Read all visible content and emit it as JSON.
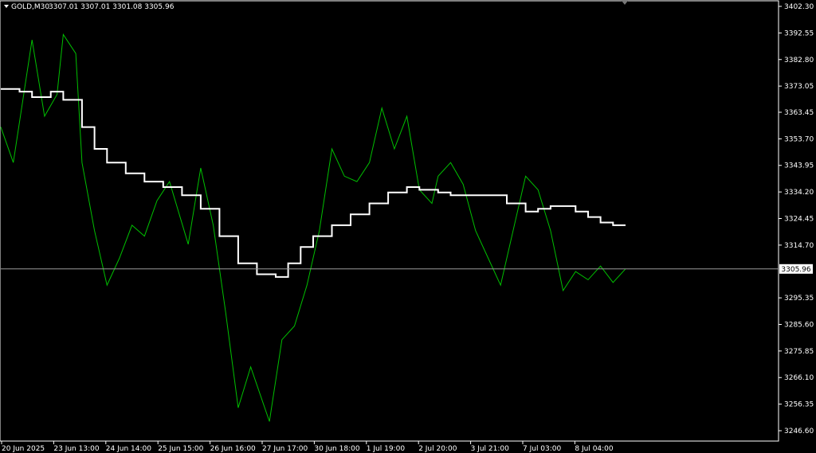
{
  "header": {
    "symbol_text": "GOLD,M30",
    "ohlc_text": "3307.01 3307.01 3301.08 3305.96"
  },
  "current_price_label": "3305.96",
  "colors": {
    "background": "#000000",
    "price_line": "#00c000",
    "ma_line": "#ffffff",
    "axis": "#ffffff",
    "current_price_line": "#9a9a9a",
    "price_tag_bg": "#ffffff",
    "price_tag_text": "#000000"
  },
  "chart_data": {
    "type": "line",
    "symbol": "GOLD",
    "timeframe": "M30",
    "y_tick_labels": [
      "3402.30",
      "3392.55",
      "3382.80",
      "3373.05",
      "3363.45",
      "3353.70",
      "3343.95",
      "3334.20",
      "3324.45",
      "3314.70",
      "3305.96",
      "3295.35",
      "3285.60",
      "3275.85",
      "3266.10",
      "3256.35",
      "3246.60"
    ],
    "x_tick_labels": [
      "20 Jun 2025",
      "23 Jun 13:00",
      "24 Jun 14:00",
      "25 Jun 15:00",
      "26 Jun 16:00",
      "27 Jun 17:00",
      "30 Jun 18:00",
      "1 Jul 19:00",
      "2 Jul 20:00",
      "3 Jul 21:00",
      "7 Jul 03:00",
      "8 Jul 04:00"
    ],
    "ylim": [
      3246.6,
      3402.3
    ],
    "current_price": 3305.96,
    "series": [
      {
        "kind": "price",
        "x": [
          0,
          0.02,
          0.05,
          0.07,
          0.09,
          0.1,
          0.12,
          0.13,
          0.15,
          0.17,
          0.19,
          0.21,
          0.23,
          0.25,
          0.27,
          0.3,
          0.32,
          0.34,
          0.36,
          0.38,
          0.4,
          0.43,
          0.45,
          0.47,
          0.49,
          0.51,
          0.53,
          0.55,
          0.57,
          0.59,
          0.61,
          0.63,
          0.65,
          0.67,
          0.69,
          0.7,
          0.72,
          0.74,
          0.76,
          0.78,
          0.8,
          0.82,
          0.84,
          0.86,
          0.88,
          0.9,
          0.92,
          0.94,
          0.96,
          0.98,
          1.0
        ],
        "y": [
          3358,
          3345,
          3390,
          3362,
          3370,
          3392,
          3385,
          3345,
          3320,
          3300,
          3310,
          3322,
          3318,
          3331,
          3338,
          3315,
          3343,
          3322,
          3290,
          3255,
          3270,
          3250,
          3280,
          3285,
          3300,
          3320,
          3350,
          3340,
          3338,
          3345,
          3365,
          3350,
          3362,
          3335,
          3330,
          3340,
          3345,
          3337,
          3320,
          3310,
          3300,
          3320,
          3340,
          3335,
          3320,
          3298,
          3305,
          3302,
          3307,
          3301,
          3306
        ]
      },
      {
        "kind": "moving_average",
        "x": [
          0,
          0.03,
          0.05,
          0.08,
          0.1,
          0.13,
          0.15,
          0.17,
          0.2,
          0.23,
          0.26,
          0.29,
          0.32,
          0.35,
          0.38,
          0.41,
          0.44,
          0.46,
          0.48,
          0.5,
          0.53,
          0.56,
          0.59,
          0.62,
          0.65,
          0.67,
          0.7,
          0.72,
          0.75,
          0.78,
          0.81,
          0.84,
          0.86,
          0.88,
          0.9,
          0.92,
          0.94,
          0.96,
          0.98,
          1.0
        ],
        "y": [
          3372,
          3371,
          3369,
          3371,
          3368,
          3358,
          3350,
          3345,
          3341,
          3338,
          3336,
          3333,
          3328,
          3318,
          3308,
          3304,
          3303,
          3308,
          3314,
          3318,
          3322,
          3326,
          3330,
          3334,
          3336,
          3335,
          3334,
          3333,
          3333,
          3333,
          3330,
          3327,
          3328,
          3329,
          3329,
          3327,
          3325,
          3323,
          3322,
          3322
        ]
      }
    ],
    "grid": false,
    "legend": "none"
  }
}
